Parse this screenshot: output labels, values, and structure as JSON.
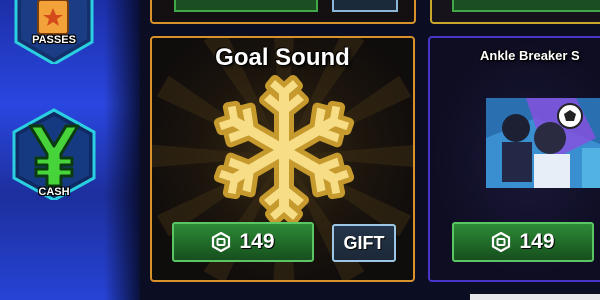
{
  "sidebar": {
    "items": [
      {
        "label": "PASSES",
        "icon": "ticket-icon"
      },
      {
        "label": "CASH",
        "icon": "yen-icon"
      }
    ]
  },
  "shop": {
    "items": [
      {
        "title": "Goal Sound",
        "price": "149",
        "gift_label": "GIFT",
        "icon": "snowflake-icon",
        "accent": "#d8912b"
      },
      {
        "title": "Ankle Breaker S",
        "price": "149",
        "icon": "character-art",
        "accent": "#4636c9"
      }
    ]
  },
  "colors": {
    "price_button": "#1f6a28",
    "gift_button_border": "#9cc6e4",
    "sidebar_blue": "#2a46e0"
  }
}
